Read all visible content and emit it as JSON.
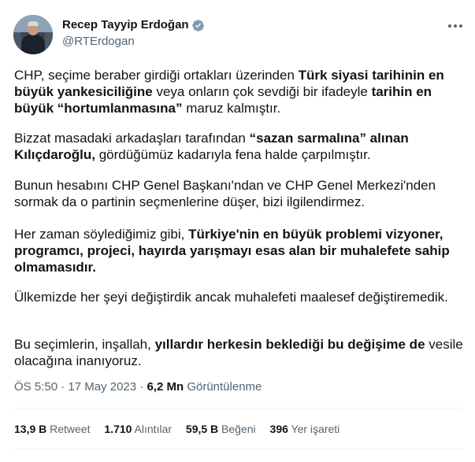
{
  "author": {
    "name": "Recep Tayyip Erdoğan",
    "handle": "@RTErdogan",
    "verified_color": "#829aab"
  },
  "tweet": {
    "p1": [
      {
        "t": "CHP, seçime beraber girdiği ortakları üzerinden ",
        "b": false
      },
      {
        "t": "Türk siyasi tarihinin en büyük yankesiciliğine",
        "b": true
      },
      {
        "t": " veya onların çok sevdiği bir ifadeyle ",
        "b": false
      },
      {
        "t": "tarihin en büyük “hortumlanmasına”",
        "b": true
      },
      {
        "t": " maruz kalmıştır.",
        "b": false
      }
    ],
    "p2": [
      {
        "t": "Bizzat masadaki arkadaşları tarafından ",
        "b": false
      },
      {
        "t": "“sazan sarmalına” alınan Kılıçdaroğlu,",
        "b": true
      },
      {
        "t": " gördüğümüz kadarıyla fena halde çarpılmıştır.",
        "b": false
      }
    ],
    "p3": [
      {
        "t": "Bunun hesabını CHP Genel Başkanı'ndan ve CHP Genel Merkezi'nden sormak da o partinin seçmenlerine düşer, bizi ilgilendirmez.",
        "b": false
      }
    ],
    "p4": [
      {
        "t": "Her zaman söylediğimiz gibi, ",
        "b": false
      },
      {
        "t": "Türkiye'nin en büyük problemi vizyoner, programcı, projeci, hayırda yarışmayı esas alan bir muhalefete sahip olmamasıdır.",
        "b": true
      }
    ],
    "p5": [
      {
        "t": "Ülkemizde her şeyi değiştirdik ancak muhalefeti maalesef değiştiremedik.",
        "b": false
      }
    ],
    "p6": [
      {
        "t": "Bu seçimlerin, inşallah, ",
        "b": false
      },
      {
        "t": "yıllardır herkesin beklediği bu değişime de",
        "b": true
      },
      {
        "t": " vesile olacağına inanıyoruz.",
        "b": false
      }
    ]
  },
  "meta": {
    "time": "ÖS 5:50",
    "sep1": " · ",
    "date": "17 May 2023",
    "sep2": " · ",
    "views_count": "6,2 Mn",
    "views_label": " Görüntülenme"
  },
  "stats": {
    "retweets": {
      "num": "13,9 B",
      "label": " Retweet"
    },
    "quotes": {
      "num": "1.710",
      "label": " Alıntılar"
    },
    "likes": {
      "num": "59,5 B",
      "label": " Beğeni"
    },
    "bookmarks": {
      "num": "396",
      "label": " Yer işareti"
    }
  },
  "icons": {
    "verified": "verified-badge-icon",
    "more": "more-options-icon"
  }
}
